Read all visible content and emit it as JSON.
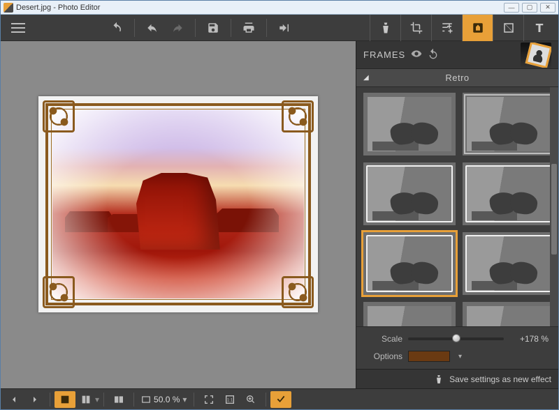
{
  "window": {
    "title": "Desert.jpg - Photo Editor"
  },
  "toolbar": {
    "tabs": [
      "flask",
      "crop",
      "sliders",
      "frames",
      "texture",
      "text"
    ],
    "active_tab_index": 3
  },
  "panel": {
    "title": "FRAMES",
    "category": "Retro",
    "thumbs_per_row": 2,
    "visible_rows": 4,
    "selected_index": 4,
    "scale_label": "Scale",
    "scale_value": "+178 %",
    "scale_percent": 178,
    "options_label": "Options",
    "options_color": "#6a3a12",
    "save_label": "Save settings as new effect"
  },
  "bottombar": {
    "zoom": "50.0 %"
  }
}
